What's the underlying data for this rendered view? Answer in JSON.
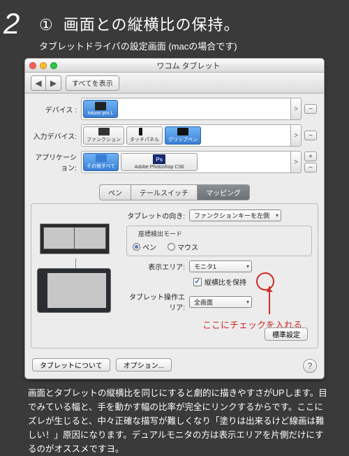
{
  "step_number": "2",
  "heading_marker": "①",
  "heading": "画面との縦横比の保持。",
  "subheading": "タブレットドライバの設定画面 (macの場合です)",
  "window": {
    "title": "ワコム タブレット",
    "show_all": "すべてを表示",
    "nav_back": "◀",
    "nav_fwd": "▶"
  },
  "pickers": {
    "device_label": "デバイス :",
    "device_item": "Intuos pro L",
    "input_label": "入力デバイス:",
    "input_items": [
      "ファンクション",
      "タッチパネル",
      "グリップペン"
    ],
    "app_label": "アプリケーション:",
    "app_items": [
      "その他すべて",
      "Adobe Photoshop CS6"
    ],
    "plus": "+",
    "minus": "−",
    "scroll": ">"
  },
  "tabs": {
    "t1": "ペン",
    "t2": "テールスイッチ",
    "t3": "マッピング"
  },
  "settings": {
    "orient_label": "タブレットの向き:",
    "orient_value": "ファンクションキーを左側",
    "mode_title": "座標検出モード",
    "mode_pen": "ペン",
    "mode_mouse": "マウス",
    "display_label": "表示エリア:",
    "display_value": "モニタ1",
    "keepratio": "縦横比を保持",
    "tabarea_label": "タブレット操作エリア:",
    "tabarea_value": "全画面",
    "standard": "標準設定"
  },
  "callout": "ここにチェックを入れる",
  "bottom": {
    "about": "タブレットについて",
    "options": "オプション...",
    "help": "?"
  },
  "description": "画面とタブレットの縦横比を同じにすると劇的に描きやすさがUPします。目でみている幅と、手を動かす幅の比率が完全にリンクするからです。ここにズレが生じると、中々正確な描写が難しくなり「塗りは出来るけど線画は難しい！」原因になります。デュアルモニタの方は表示エリアを片側だけにするのがオススメですヨ。"
}
